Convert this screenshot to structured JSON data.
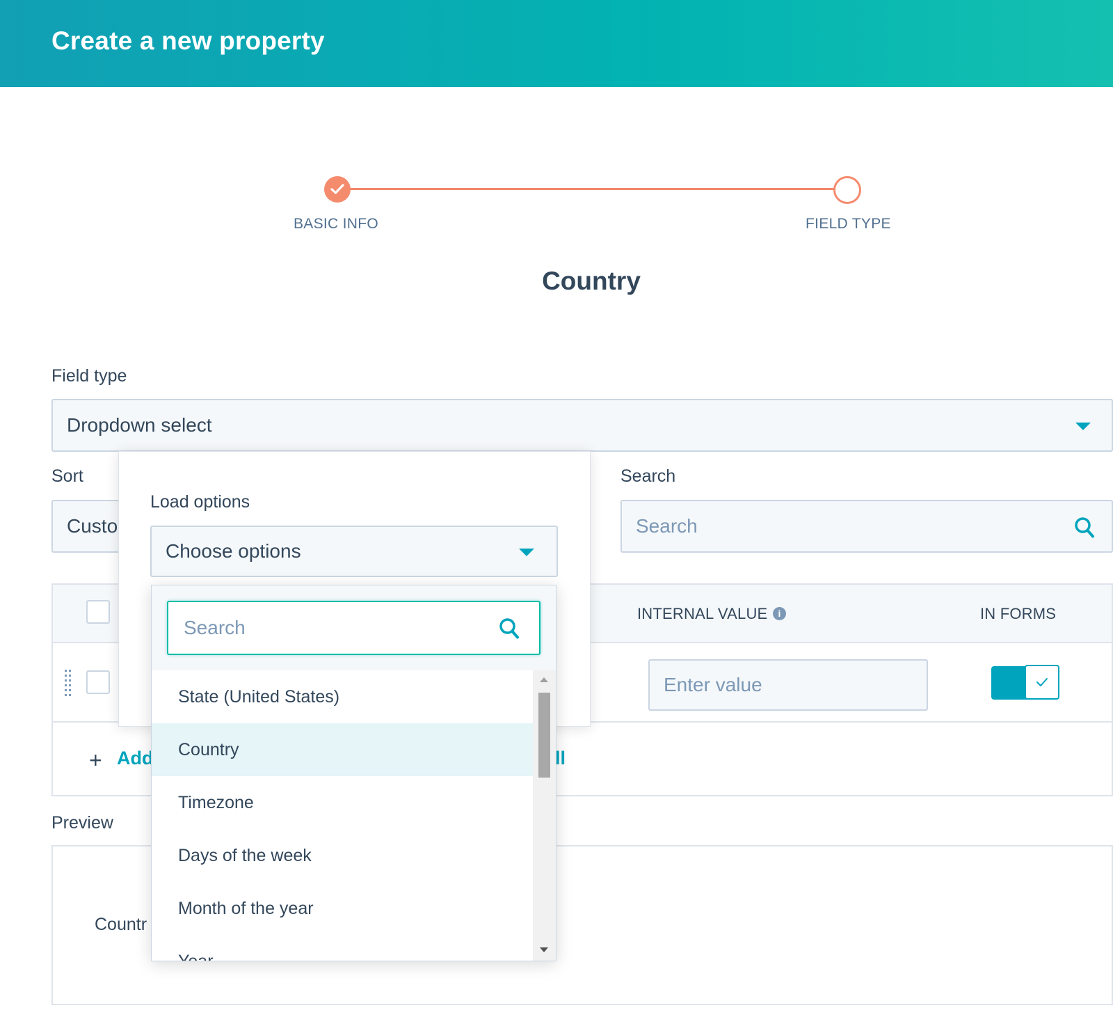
{
  "header": {
    "title": "Create a new property"
  },
  "stepper": {
    "steps": [
      {
        "label": "BASIC INFO",
        "state": "done"
      },
      {
        "label": "FIELD TYPE",
        "state": "current"
      }
    ]
  },
  "section": {
    "title": "Country"
  },
  "field_type": {
    "label": "Field type",
    "value": "Dropdown select"
  },
  "sort": {
    "label": "Sort",
    "value": "Custo"
  },
  "search": {
    "label": "Search",
    "placeholder": "Search"
  },
  "table": {
    "headers": {
      "internal_value": "INTERNAL VALUE",
      "in_forms": "IN FORMS"
    },
    "row": {
      "internal_value_placeholder": "Enter value",
      "in_forms": true
    },
    "add_label": "Add",
    "partial_text": "ll"
  },
  "preview": {
    "label": "Preview",
    "text": "Countr"
  },
  "load_options": {
    "label": "Load options",
    "select_value": "Choose options",
    "menu": {
      "search_placeholder": "Search",
      "items": [
        "State (United States)",
        "Country",
        "Timezone",
        "Days of the week",
        "Month of the year",
        "Year"
      ],
      "selected": "Country"
    }
  },
  "colors": {
    "accent": "#00a4bd",
    "header_start": "#11a0b4",
    "header_end": "#14c0b0",
    "step": "#f58b6d"
  }
}
